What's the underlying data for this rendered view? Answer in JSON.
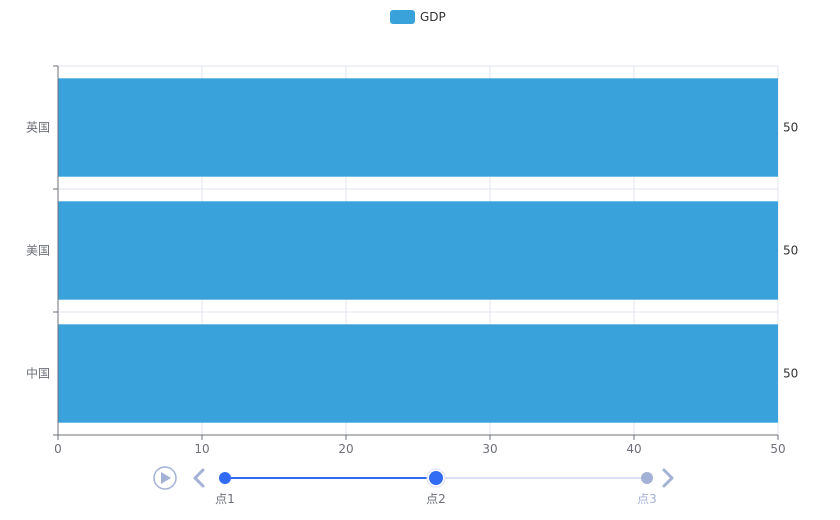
{
  "chart_data": {
    "type": "bar",
    "orientation": "horizontal",
    "categories": [
      "中国",
      "美国",
      "英国"
    ],
    "series": [
      {
        "name": "GDP",
        "values": [
          50,
          50,
          50
        ]
      }
    ],
    "xlim": [
      0,
      50
    ],
    "x_ticks": [
      0,
      10,
      20,
      30,
      40,
      50
    ],
    "legend_position": "top-center",
    "grid": true,
    "data_labels": "right"
  },
  "legend": {
    "label": "GDP"
  },
  "timeline": {
    "points": [
      {
        "label": "点1",
        "state": "passed"
      },
      {
        "label": "点2",
        "state": "current"
      },
      {
        "label": "点3",
        "state": "upcoming"
      }
    ]
  },
  "colors": {
    "bar": "#3aa2da",
    "timeline_active": "#316bf3",
    "timeline_inactive": "#a4b1d7",
    "grid": "#e0e6f1",
    "axis": "#6e7079"
  }
}
